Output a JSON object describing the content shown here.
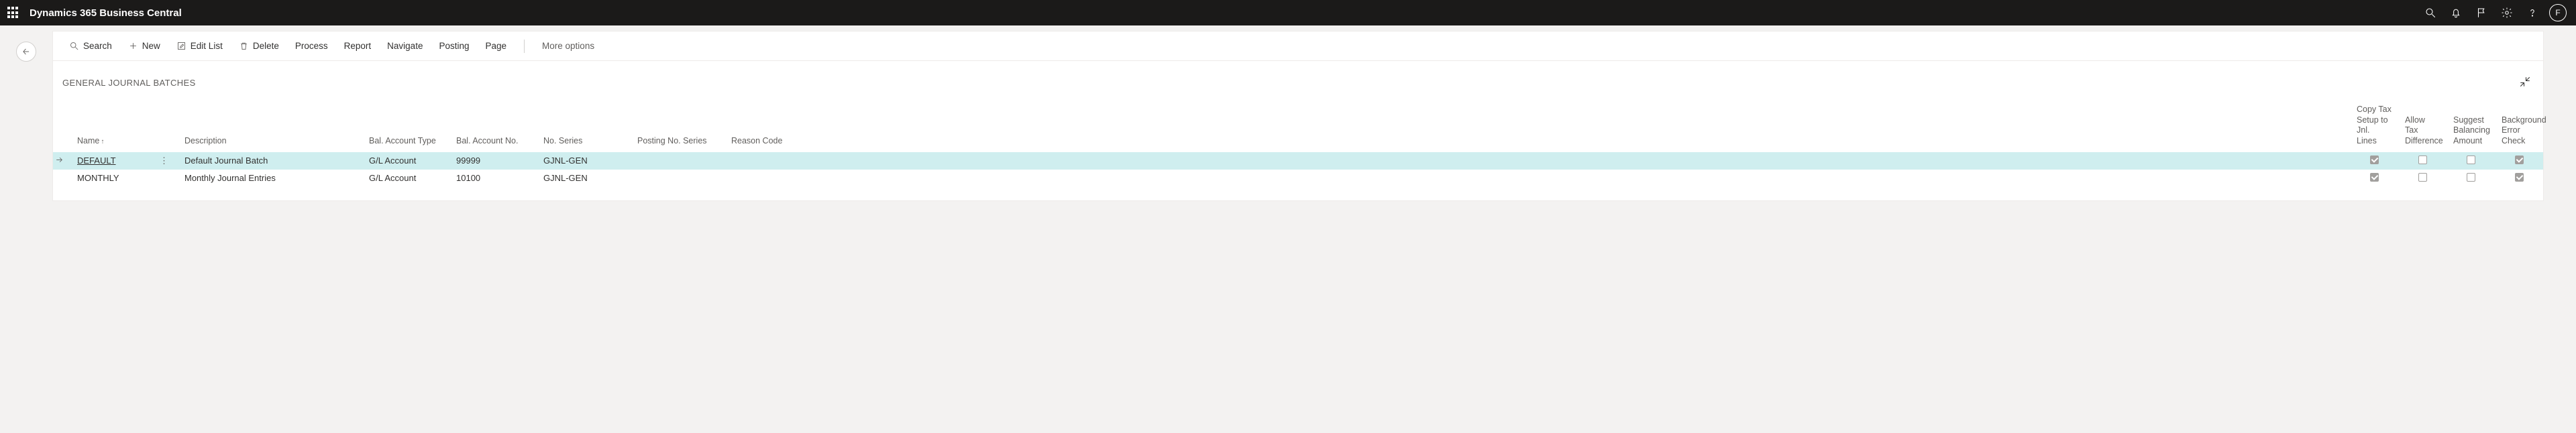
{
  "topbar": {
    "app_title": "Dynamics 365 Business Central",
    "avatar_initial": "F"
  },
  "commands": {
    "search": "Search",
    "new": "New",
    "edit_list": "Edit List",
    "delete": "Delete",
    "process": "Process",
    "report": "Report",
    "navigate": "Navigate",
    "posting": "Posting",
    "page": "Page",
    "more": "More options"
  },
  "page": {
    "title": "GENERAL JOURNAL BATCHES"
  },
  "columns": {
    "name": "Name",
    "description": "Description",
    "bal_type": "Bal. Account Type",
    "bal_no": "Bal. Account No.",
    "no_series": "No. Series",
    "posting_no_series": "Posting No. Series",
    "reason": "Reason Code",
    "copy_tax": "Copy Tax Setup to Jnl. Lines",
    "allow_tax": "Allow Tax Difference",
    "suggest_bal": "Suggest Balancing Amount",
    "bg_check": "Background Error Check"
  },
  "rows": [
    {
      "name": "DEFAULT",
      "description": "Default Journal Batch",
      "bal_type": "G/L Account",
      "bal_no": "99999",
      "no_series": "GJNL-GEN",
      "posting_no_series": "",
      "reason": "",
      "copy_tax": true,
      "allow_tax": false,
      "suggest_bal": false,
      "bg_check": true,
      "selected": true
    },
    {
      "name": "MONTHLY",
      "description": "Monthly Journal Entries",
      "bal_type": "G/L Account",
      "bal_no": "10100",
      "no_series": "GJNL-GEN",
      "posting_no_series": "",
      "reason": "",
      "copy_tax": true,
      "allow_tax": false,
      "suggest_bal": false,
      "bg_check": true,
      "selected": false
    }
  ]
}
